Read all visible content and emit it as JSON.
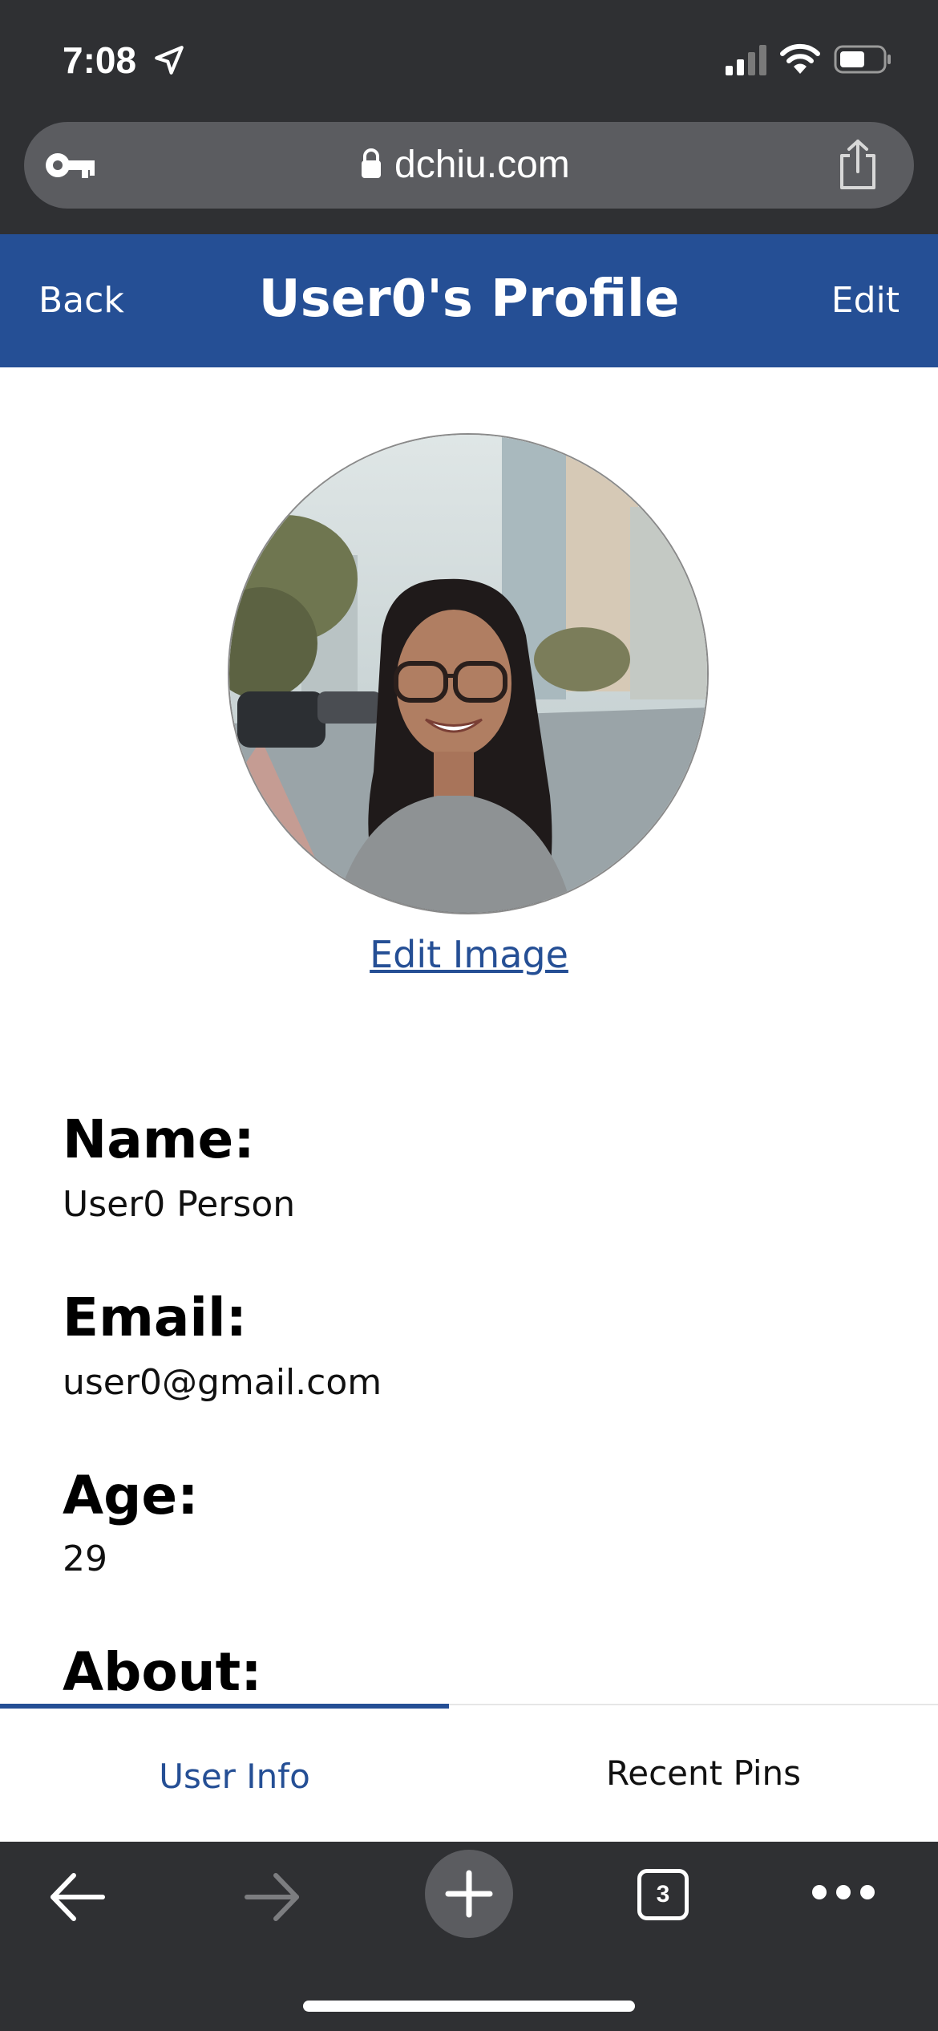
{
  "status_bar": {
    "time": "7:08"
  },
  "browser": {
    "url": "dchiu.com",
    "tab_count": "3"
  },
  "header": {
    "back_label": "Back",
    "title": "User0's Profile",
    "edit_label": "Edit"
  },
  "profile": {
    "edit_image_label": "Edit Image",
    "fields": [
      {
        "label": "Name:",
        "value": "User0 Person"
      },
      {
        "label": "Email:",
        "value": "user0@gmail.com"
      },
      {
        "label": "Age:",
        "value": "29"
      },
      {
        "label": "About:",
        "value": ""
      }
    ]
  },
  "tabs": {
    "items": [
      {
        "label": "User Info",
        "active": true
      },
      {
        "label": "Recent Pins",
        "active": false
      }
    ]
  },
  "colors": {
    "accent": "#254f95",
    "chrome": "#2f3033",
    "url_bar": "#5b5c60"
  },
  "icons": {
    "status": [
      "location-arrow-icon",
      "cellular-signal-icon",
      "wifi-icon",
      "battery-icon"
    ],
    "url_bar": [
      "key-icon",
      "lock-icon",
      "share-icon"
    ],
    "toolbar": [
      "back-arrow-icon",
      "forward-arrow-icon",
      "plus-icon",
      "tabs-icon",
      "more-icon"
    ]
  }
}
